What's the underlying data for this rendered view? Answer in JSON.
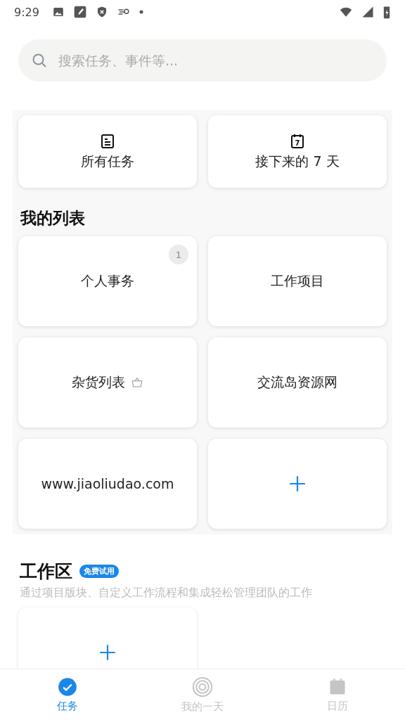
{
  "status_bar": {
    "time": "9:29"
  },
  "search": {
    "placeholder": "搜索任务、事件等..."
  },
  "smart_lists": [
    {
      "label": "所有任务",
      "kind": "tasks"
    },
    {
      "label": "接下来的 7 天",
      "kind": "calendar",
      "icon_text": "7"
    }
  ],
  "my_lists": {
    "title": "我的列表",
    "items": [
      {
        "kind": "list",
        "label": "个人事务",
        "badge": "1"
      },
      {
        "kind": "list",
        "label": "工作项目"
      },
      {
        "kind": "list",
        "label": "杂货列表",
        "shared": true
      },
      {
        "kind": "list",
        "label": "交流岛资源网"
      },
      {
        "kind": "list",
        "label": "www.jiaoliudao.com"
      },
      {
        "kind": "add"
      }
    ]
  },
  "workspace": {
    "title": "工作区",
    "badge": "免费试用",
    "description": "通过项目版块、自定义工作流程和集成轻松管理团队的工作"
  },
  "bottom_nav": [
    {
      "label": "任务",
      "kind": "check",
      "selected": true
    },
    {
      "label": "我的一天",
      "kind": "target",
      "selected": false
    },
    {
      "label": "日历",
      "kind": "calendar",
      "selected": false
    }
  ]
}
